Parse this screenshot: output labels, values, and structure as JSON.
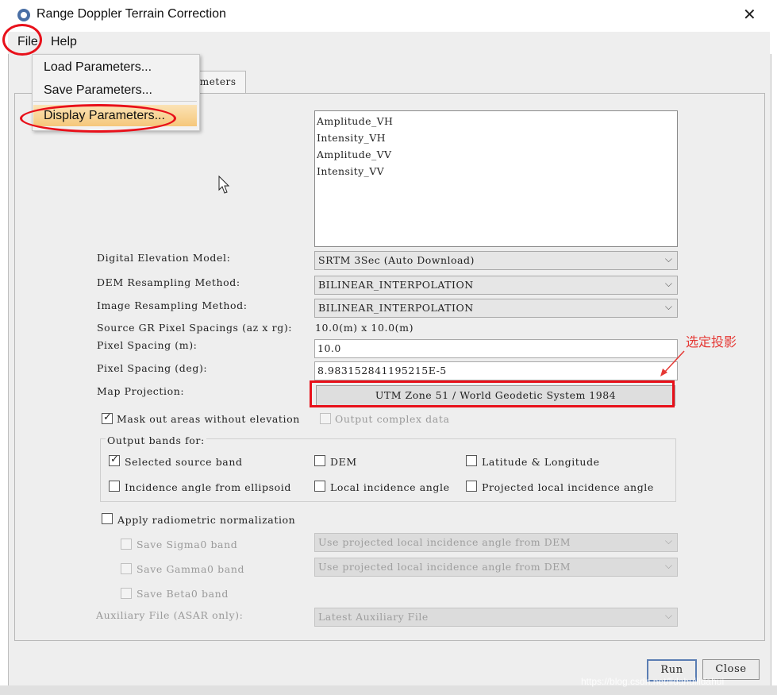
{
  "window": {
    "title": "Range Doppler Terrain Correction"
  },
  "menubar": {
    "file": "File",
    "help": "Help"
  },
  "file_menu": {
    "items": [
      "Load Parameters...",
      "Save Parameters...",
      "Display Parameters..."
    ]
  },
  "tab": {
    "label": "ameters"
  },
  "source_bands": [
    "Amplitude_VH",
    "Intensity_VH",
    "Amplitude_VV",
    "Intensity_VV"
  ],
  "form": {
    "dem_label": "Digital Elevation Model:",
    "dem_value": "SRTM 3Sec (Auto Download)",
    "dem_resampling_label": "DEM Resampling Method:",
    "dem_resampling_value": "BILINEAR_INTERPOLATION",
    "img_resampling_label": "Image Resampling Method:",
    "img_resampling_value": "BILINEAR_INTERPOLATION",
    "gr_spacing_label": "Source GR Pixel Spacings (az x rg):",
    "gr_spacing_value": "10.0(m) x 10.0(m)",
    "pixel_m_label": "Pixel Spacing (m):",
    "pixel_m_value": "10.0",
    "pixel_deg_label": "Pixel Spacing (deg):",
    "pixel_deg_value": "8.983152841195215E-5",
    "map_proj_label": "Map Projection:",
    "map_proj_value": "UTM Zone 51 / World Geodetic System 1984"
  },
  "annotation": {
    "text": "选定投影",
    "color": "#e8101a"
  },
  "options": {
    "mask_label": "Mask out areas without elevation",
    "complex_label": "Output complex data",
    "output_bands_title": "Output bands for:",
    "selected_source": "Selected source band",
    "dem": "DEM",
    "lat_lon": "Latitude & Longitude",
    "incidence_ellipsoid": "Incidence angle from ellipsoid",
    "local_incidence": "Local incidence angle",
    "projected_local_incidence": "Projected local incidence angle",
    "radiometric_label": "Apply radiometric normalization",
    "sigma0": "Save Sigma0 band",
    "gamma0": "Save Gamma0 band",
    "beta0": "Save Beta0 band",
    "sigma0_combo": "Use projected local incidence angle from DEM",
    "gamma0_combo": "Use projected local incidence angle from DEM",
    "aux_label": "Auxiliary File (ASAR only):",
    "aux_value": "Latest Auxiliary File"
  },
  "buttons": {
    "run": "Run",
    "close": "Close"
  },
  "watermark": "https://blog.csdn.net/lidahuilidahui"
}
